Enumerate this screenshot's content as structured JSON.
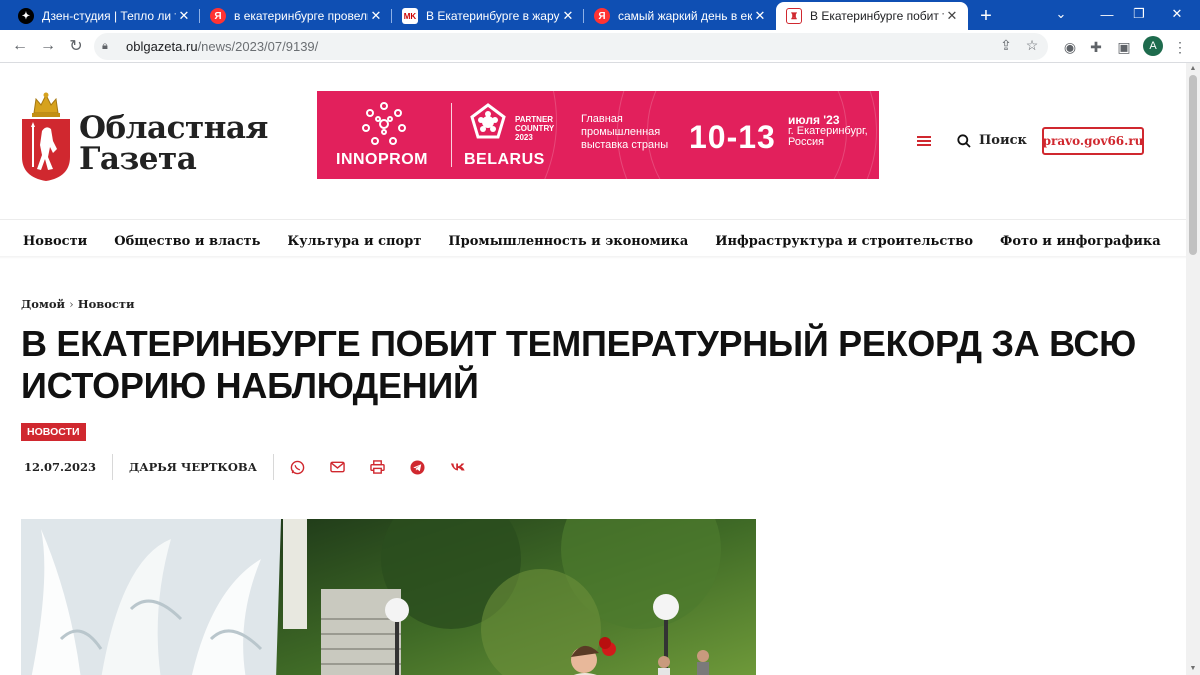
{
  "browser": {
    "tabs": [
      {
        "title": "Дзен-студия | Тепло ли тебе",
        "favicon": "dzen-icon",
        "active": false
      },
      {
        "title": "в екатеринбурге провели об",
        "favicon": "yandex-icon",
        "active": false
      },
      {
        "title": "В Екатеринбурге в жару в к",
        "favicon": "mk-icon",
        "active": false
      },
      {
        "title": "самый жаркий день в екате",
        "favicon": "yandex-icon",
        "active": false
      },
      {
        "title": "В Екатеринбурге побит тем",
        "favicon": "oblgazeta-icon",
        "active": true
      }
    ],
    "new_tab": "+",
    "url_host": "oblgazeta.ru",
    "url_path": "/news/2023/07/9139/",
    "profile_initial": "A"
  },
  "site": {
    "logo_line1": "Областная",
    "logo_line2": "Газета",
    "search_label": "Поиск",
    "pravo_link": "pravo.gov66.ru",
    "nav": [
      "Новости",
      "Общество и власть",
      "Культура и спорт",
      "Промышленность и экономика",
      "Инфраструктура и строительство",
      "Фото и инфографика"
    ]
  },
  "banner": {
    "brand": "INNOPROM",
    "partner_line1": "PARTNER",
    "partner_line2": "COUNTRY",
    "partner_line3": "2023",
    "country": "BELARUS",
    "expo_line1": "Главная",
    "expo_line2": "промышленная",
    "expo_line3": "выставка страны",
    "dates": "10-13",
    "month": "июля '23",
    "city": "г. Екатеринбург,",
    "country_ru": "Россия",
    "color": "#e2205c"
  },
  "article": {
    "breadcrumb_home": "Домой",
    "breadcrumb_section": "Новости",
    "title": "В Екатеринбурге побит температурный рекорд за всю историю наблюдений",
    "category": "НОВОСТИ",
    "date": "12.07.2023",
    "author": "ДАРЬЯ ЧЕРТКОВА",
    "share_icons": [
      "whatsapp-icon",
      "email-icon",
      "print-icon",
      "telegram-icon",
      "vk-icon"
    ]
  },
  "colors": {
    "accent": "#d0282f",
    "tabbar": "#0f4fb3"
  }
}
